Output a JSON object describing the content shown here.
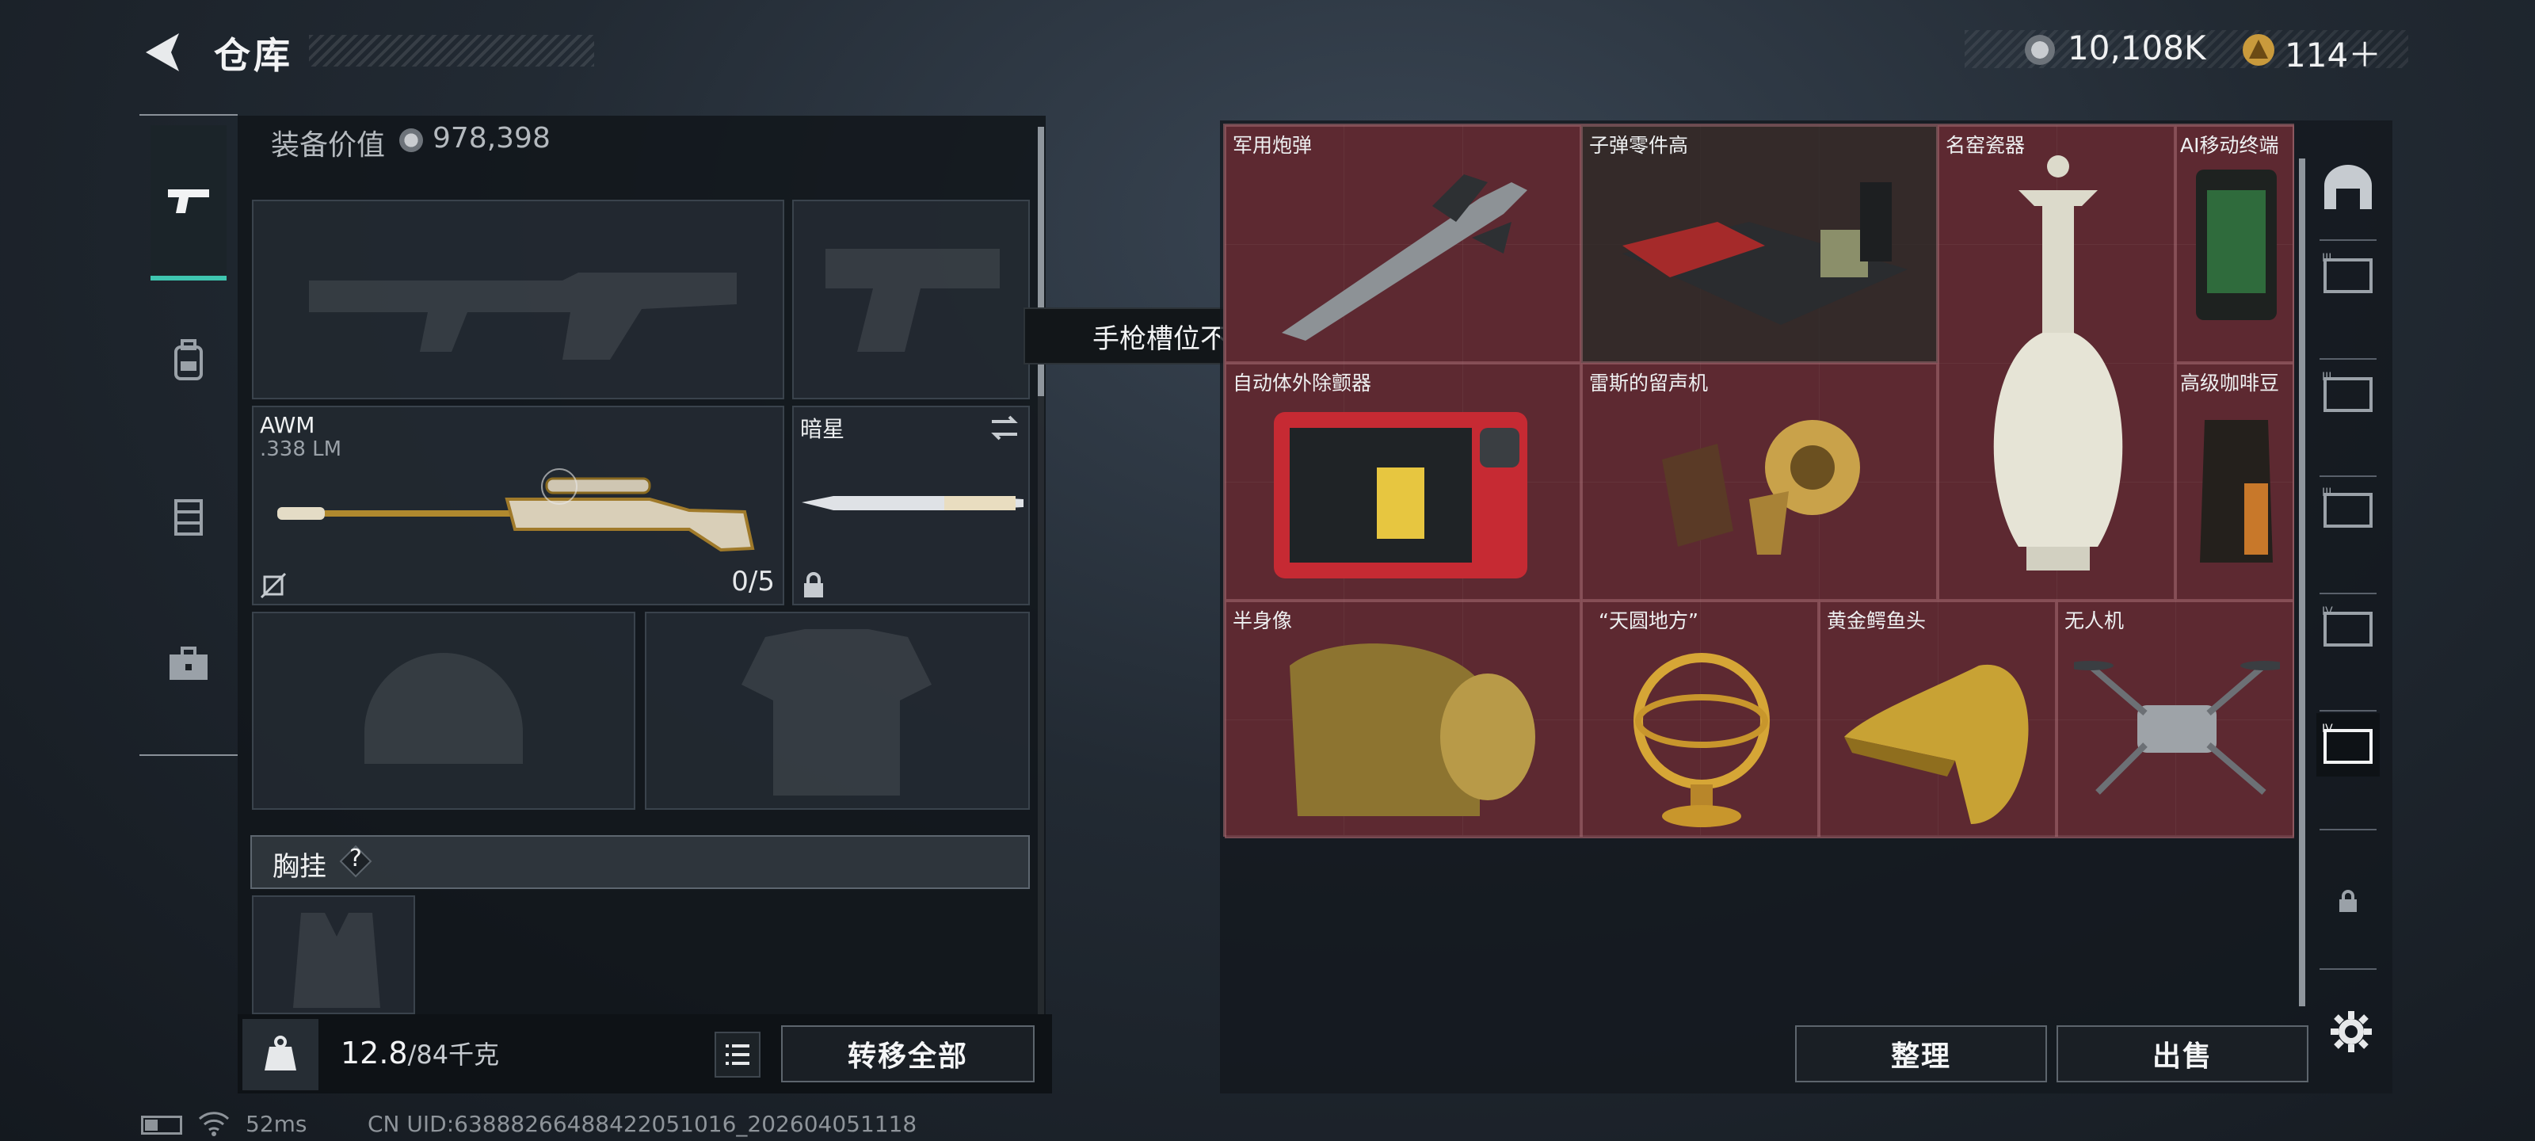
{
  "header": {
    "title": "仓库"
  },
  "currency": {
    "coins": "10,108K",
    "tickets": "114＋"
  },
  "equipment": {
    "value_label": "装备价值",
    "value": "978,398",
    "primary_slot": {
      "name": "AWM",
      "ammo": ".338 LM",
      "ammo_count": "0/5"
    },
    "melee_slot": {
      "name": "暗星"
    },
    "chest_rig_label": "胸挂",
    "help": "?"
  },
  "weight": {
    "current": "12.8",
    "max": "/84千克",
    "kg_icon_text": "KG"
  },
  "buttons": {
    "transfer_all": "转移全部",
    "organize": "整理",
    "sell": "出售"
  },
  "tooltip": "手枪槽位不能放入此道具类型",
  "storage_items": [
    "军用炮弹",
    "子弹零件高",
    "名窑瓷器",
    "AI移动终端",
    "自动体外除颤器",
    "雷斯的留声机",
    "高级咖啡豆",
    "半身像",
    "“天圆地方”",
    "黄金鳄鱼头",
    "无人机"
  ],
  "status": {
    "ping": "52ms",
    "uid": "CN UID:6388826648842205101​6_202604051118"
  },
  "colors": {
    "accent": "#3fc6b0",
    "grid_red": "#4a2127",
    "panel": "#12161b"
  },
  "icons": [
    "back-arrow-icon",
    "coin-icon",
    "ticket-icon",
    "pistol-icon",
    "backpack-icon",
    "vest-icon",
    "briefcase-icon",
    "swap-icon",
    "lock-icon",
    "no-bullet-icon",
    "kg-weight-icon",
    "list-icon",
    "gear-icon"
  ]
}
